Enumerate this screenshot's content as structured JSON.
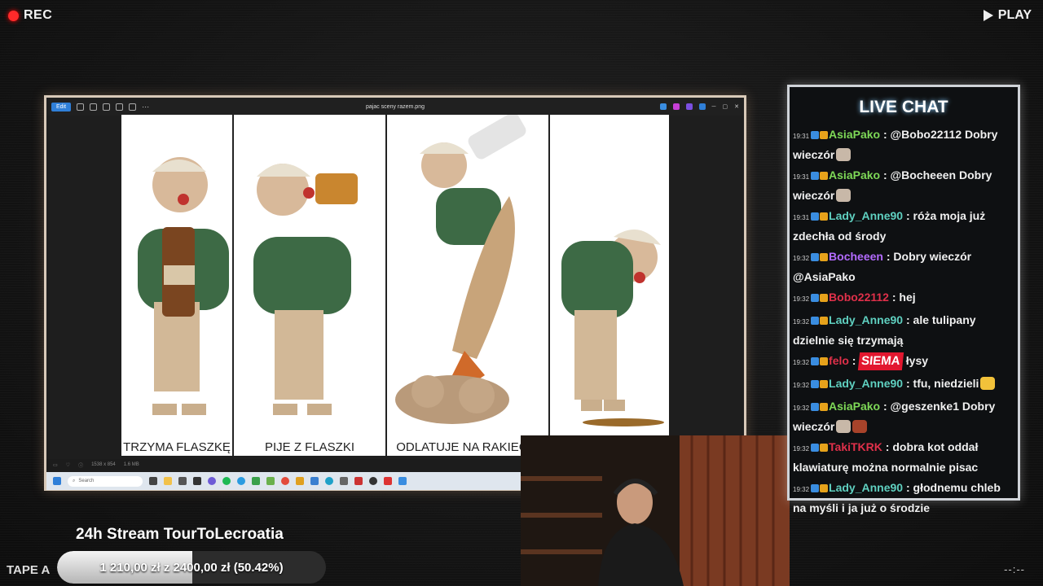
{
  "overlay": {
    "rec_label": "REC",
    "play_label": "PLAY",
    "tape_label": "TAPE A",
    "counter": "--:--"
  },
  "viewer": {
    "edit_label": "Edit",
    "file_title": "pajac sceny razem.png",
    "info_dimensions": "1538 x 854",
    "info_size": "1.6 MB",
    "captions": [
      "TRZYMA FLASZKĘ",
      "PIJE Z FLASZKI",
      "ODLATUJE NA RAKIECIE",
      ""
    ]
  },
  "taskbar": {
    "search_placeholder": "Search"
  },
  "chat": {
    "title": "LIVE CHAT",
    "messages": [
      {
        "time": "19:31",
        "user": "AsiaPako",
        "color": "#7ed957",
        "text": "@Bobo22112 Dobry wieczór",
        "emotes": [
          "dog"
        ]
      },
      {
        "time": "19:31",
        "user": "AsiaPako",
        "color": "#7ed957",
        "text": "@Bocheeen Dobry wieczór",
        "emotes": [
          "dog"
        ]
      },
      {
        "time": "19:31",
        "user": "Lady_Anne90",
        "color": "#5fd0c0",
        "text": "róża moja już zdechła od środy",
        "emotes": []
      },
      {
        "time": "19:32",
        "user": "Bocheeen",
        "color": "#b36bff",
        "text": "Dobry wieczór @AsiaPako",
        "emotes": []
      },
      {
        "time": "19:32",
        "user": "Bobo22112",
        "color": "#e0304a",
        "text": "hej",
        "emotes": []
      },
      {
        "time": "19:32",
        "user": "Lady_Anne90",
        "color": "#5fd0c0",
        "text": "ale tulipany dzielnie się trzymają",
        "emotes": []
      },
      {
        "time": "19:32",
        "user": "felo",
        "color": "#e0304a",
        "text": "łysy",
        "emotes": [
          "SIEMA"
        ]
      },
      {
        "time": "19:32",
        "user": "Lady_Anne90",
        "color": "#5fd0c0",
        "text": "tfu, niedzieli",
        "emotes": [
          "laugh"
        ]
      },
      {
        "time": "19:32",
        "user": "AsiaPako",
        "color": "#7ed957",
        "text": "@geszenke1 Dobry wieczór",
        "emotes": [
          "dog",
          "meat"
        ]
      },
      {
        "time": "19:32",
        "user": "TakiTKRK",
        "color": "#e0304a",
        "text": "dobra kot oddał klawiaturę można normalnie pisac",
        "emotes": []
      },
      {
        "time": "19:32",
        "user": "Lady_Anne90",
        "color": "#5fd0c0",
        "text": "głodnemu chleb na myśli i ja już o środzie",
        "emotes": []
      }
    ]
  },
  "stream": {
    "title": "24h Stream TourToLecroatia",
    "goal_text": "1 210,00 zł  z  2400,00 zł  (50.42%)",
    "goal_fraction": 0.5042
  }
}
